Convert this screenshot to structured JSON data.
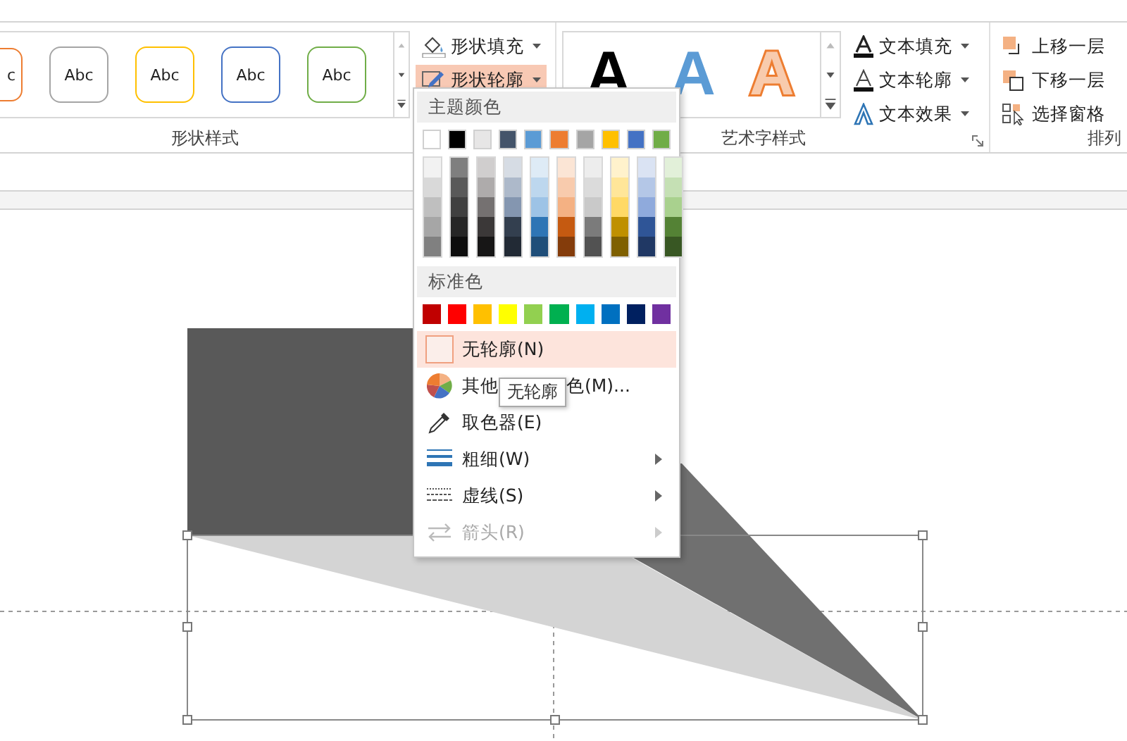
{
  "ribbon": {
    "shape_styles": {
      "gallery": [
        {
          "label": "c",
          "color": "#ed7d31"
        },
        {
          "label": "Abc",
          "color": "#a5a5a5"
        },
        {
          "label": "Abc",
          "color": "#ffc000"
        },
        {
          "label": "Abc",
          "color": "#4472c4"
        },
        {
          "label": "Abc",
          "color": "#70ad47"
        }
      ],
      "buttons": [
        {
          "label": "形状填充",
          "kind": "fill",
          "selected": false
        },
        {
          "label": "形状轮廓",
          "kind": "outline",
          "selected": true
        }
      ],
      "group_label": "形状样式"
    },
    "wordart_styles": {
      "gallery": [
        {
          "label": "A",
          "kind": "solid",
          "color": "#000000"
        },
        {
          "label": "A",
          "kind": "solid",
          "color": "#5b9bd5"
        },
        {
          "label": "A",
          "kind": "outlined",
          "color": "#f8cbad"
        }
      ],
      "buttons": [
        {
          "label": "文本填充",
          "kind": "text-fill"
        },
        {
          "label": "文本轮廓",
          "kind": "text-outline"
        },
        {
          "label": "文本效果",
          "kind": "text-effect"
        }
      ],
      "group_label": "艺术字样式"
    },
    "arrange": {
      "buttons": [
        {
          "label": "上移一层",
          "kind": "forward"
        },
        {
          "label": "下移一层",
          "kind": "backward"
        },
        {
          "label": "选择窗格",
          "kind": "pane"
        }
      ],
      "group_label": "排列"
    }
  },
  "outline_menu": {
    "theme_header": "主题颜色",
    "theme_colors": [
      {
        "color": "#ffffff",
        "shades": [
          {
            "color": "#f2f2f2"
          },
          {
            "color": "#d9d9d9"
          },
          {
            "color": "#bfbfbf"
          },
          {
            "color": "#a6a6a6"
          },
          {
            "color": "#808080"
          }
        ]
      },
      {
        "color": "#000000",
        "shades": [
          {
            "color": "#7f7f7f"
          },
          {
            "color": "#595959"
          },
          {
            "color": "#404040"
          },
          {
            "color": "#262626"
          },
          {
            "color": "#0d0d0d"
          }
        ]
      },
      {
        "color": "#e7e6e6",
        "shades": [
          {
            "color": "#d0cece"
          },
          {
            "color": "#aeabab"
          },
          {
            "color": "#757171"
          },
          {
            "color": "#3b3838"
          },
          {
            "color": "#171616"
          }
        ]
      },
      {
        "color": "#44546a",
        "shades": [
          {
            "color": "#d6dce4"
          },
          {
            "color": "#adb9ca"
          },
          {
            "color": "#8496b0"
          },
          {
            "color": "#333f4f"
          },
          {
            "color": "#222a35"
          }
        ]
      },
      {
        "color": "#5b9bd5",
        "shades": [
          {
            "color": "#deebf6"
          },
          {
            "color": "#bdd7ee"
          },
          {
            "color": "#9dc3e6"
          },
          {
            "color": "#2e75b5"
          },
          {
            "color": "#1f4e79"
          }
        ]
      },
      {
        "color": "#ed7d31",
        "shades": [
          {
            "color": "#fbe5d5"
          },
          {
            "color": "#f8cbad"
          },
          {
            "color": "#f4b183"
          },
          {
            "color": "#c55a11"
          },
          {
            "color": "#843c0b"
          }
        ]
      },
      {
        "color": "#a5a5a5",
        "shades": [
          {
            "color": "#ededed"
          },
          {
            "color": "#dbdbdb"
          },
          {
            "color": "#c9c9c9"
          },
          {
            "color": "#7b7b7b"
          },
          {
            "color": "#525252"
          }
        ]
      },
      {
        "color": "#ffc000",
        "shades": [
          {
            "color": "#fff2cc"
          },
          {
            "color": "#ffe699"
          },
          {
            "color": "#ffd966"
          },
          {
            "color": "#bf9000"
          },
          {
            "color": "#7f6000"
          }
        ]
      },
      {
        "color": "#4472c4",
        "shades": [
          {
            "color": "#dae3f3"
          },
          {
            "color": "#b4c7e7"
          },
          {
            "color": "#8faadc"
          },
          {
            "color": "#2f5597"
          },
          {
            "color": "#203864"
          }
        ]
      },
      {
        "color": "#70ad47",
        "shades": [
          {
            "color": "#e2f0d9"
          },
          {
            "color": "#c5e0b4"
          },
          {
            "color": "#a9d18e"
          },
          {
            "color": "#548235"
          },
          {
            "color": "#385723"
          }
        ]
      }
    ],
    "standard_header": "标准色",
    "standard_colors": [
      {
        "color": "#c00000"
      },
      {
        "color": "#ff0000"
      },
      {
        "color": "#ffc000"
      },
      {
        "color": "#ffff00"
      },
      {
        "color": "#92d050"
      },
      {
        "color": "#00b050"
      },
      {
        "color": "#00b0f0"
      },
      {
        "color": "#0070c0"
      },
      {
        "color": "#002060"
      },
      {
        "color": "#7030a0"
      }
    ],
    "items": [
      {
        "kind": "no-outline",
        "label_parts": [
          "无轮廓(N)"
        ],
        "selected": true,
        "disabled": false,
        "submenu": false
      },
      {
        "kind": "more-colors",
        "label_parts": [
          "其他",
          "色(M)..."
        ],
        "selected": false,
        "disabled": false,
        "submenu": false
      },
      {
        "kind": "eyedropper",
        "label_parts": [
          "取色器(E)"
        ],
        "selected": false,
        "disabled": false,
        "submenu": false
      },
      {
        "kind": "weight",
        "label_parts": [
          "粗细(W)"
        ],
        "selected": false,
        "disabled": false,
        "submenu": true
      },
      {
        "kind": "dashes",
        "label_parts": [
          "虚线(S)"
        ],
        "selected": false,
        "disabled": false,
        "submenu": true
      },
      {
        "kind": "arrows",
        "label_parts": [
          "箭头(R)"
        ],
        "selected": false,
        "disabled": true,
        "submenu": true
      }
    ]
  },
  "tooltip": "无轮廓"
}
